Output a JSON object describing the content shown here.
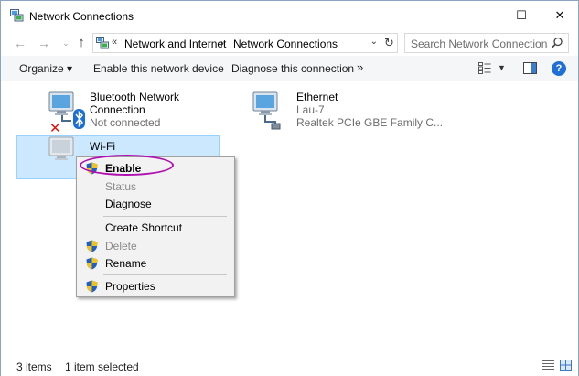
{
  "window": {
    "title": "Network Connections",
    "minimize_symbol": "—",
    "maximize_symbol": "☐",
    "close_symbol": "✕"
  },
  "address": {
    "overflow_symbol": "«",
    "separator_symbol": "›",
    "dropdown_symbol": "⌄",
    "crumbs": [
      "Network and Internet",
      "Network Connections"
    ],
    "refresh_symbol": "↻",
    "search_placeholder": "Search Network Connections"
  },
  "nav": {
    "back_symbol": "←",
    "forward_symbol": "→",
    "recent_symbol": "⌄",
    "up_symbol": "↑"
  },
  "toolbar": {
    "organize": "Organize ▾",
    "enable": "Enable this network device",
    "diagnose": "Diagnose this connection",
    "more": "»",
    "view_dropdown": "▼",
    "help": "?"
  },
  "items": [
    {
      "name": "Bluetooth Network Connection",
      "sub1": "Not connected",
      "sub2": "",
      "icon": "bluetooth-network-icon"
    },
    {
      "name": "Ethernet",
      "sub1": "Lau-7",
      "sub2": "Realtek PCIe GBE Family C...",
      "icon": "ethernet-network-icon"
    },
    {
      "name": "Wi-Fi",
      "sub1": "",
      "sub2": "",
      "icon": "wifi-network-icon",
      "selected": true
    }
  ],
  "context_menu": {
    "items": [
      {
        "label": "Enable",
        "shield": true,
        "enabled": true,
        "default": true
      },
      {
        "label": "Status",
        "shield": false,
        "enabled": false
      },
      {
        "label": "Diagnose",
        "shield": false,
        "enabled": true
      },
      {
        "label": "Create Shortcut",
        "shield": false,
        "enabled": true
      },
      {
        "label": "Delete",
        "shield": true,
        "enabled": false
      },
      {
        "label": "Rename",
        "shield": true,
        "enabled": true
      },
      {
        "label": "Properties",
        "shield": true,
        "enabled": true
      }
    ]
  },
  "status": {
    "count": "3 items",
    "selection": "1 item selected"
  },
  "colors": {
    "selection_bg": "#cce8ff",
    "highlight_ring": "#b010b0",
    "help_blue": "#1f6fd6",
    "disabled_x": "#e01010",
    "bluetooth_blue": "#1a6fd6"
  }
}
